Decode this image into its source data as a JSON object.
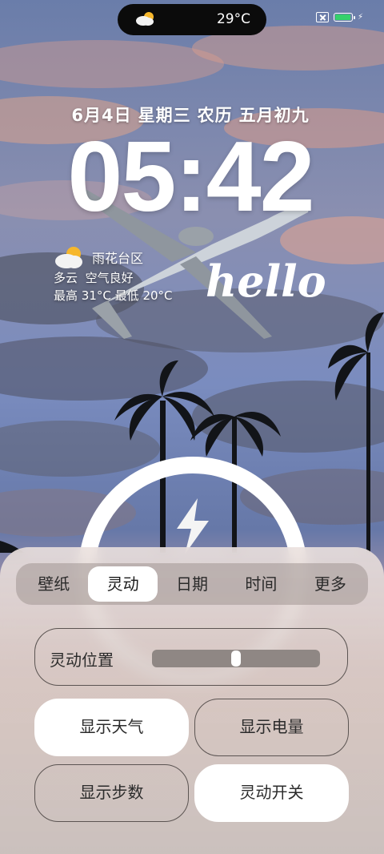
{
  "status": {
    "temperature": "29°C",
    "weather_icon": "partly-cloudy-icon",
    "battery_level": 0.95,
    "battery_color": "#35d16b",
    "charging": true
  },
  "lockscreen": {
    "date": "6月4日",
    "weekday": "星期三",
    "lunar_label": "农历",
    "lunar_date": "五月初九",
    "time": "05:42",
    "weather": {
      "district": "雨花台区",
      "condition": "多云",
      "air_quality": "空气良好",
      "high_label": "最高",
      "high": "31°C",
      "low_label": "最低",
      "low": "20°C"
    },
    "greeting": "hello"
  },
  "panel": {
    "tabs": [
      {
        "label": "壁纸",
        "active": false
      },
      {
        "label": "灵动",
        "active": true
      },
      {
        "label": "日期",
        "active": false
      },
      {
        "label": "时间",
        "active": false
      },
      {
        "label": "更多",
        "active": false
      }
    ],
    "position": {
      "label": "灵动位置",
      "value": 0.5
    },
    "buttons": [
      {
        "label": "显示天气",
        "on": true
      },
      {
        "label": "显示电量",
        "on": false
      },
      {
        "label": "显示步数",
        "on": false
      },
      {
        "label": "灵动开关",
        "on": true
      }
    ]
  }
}
